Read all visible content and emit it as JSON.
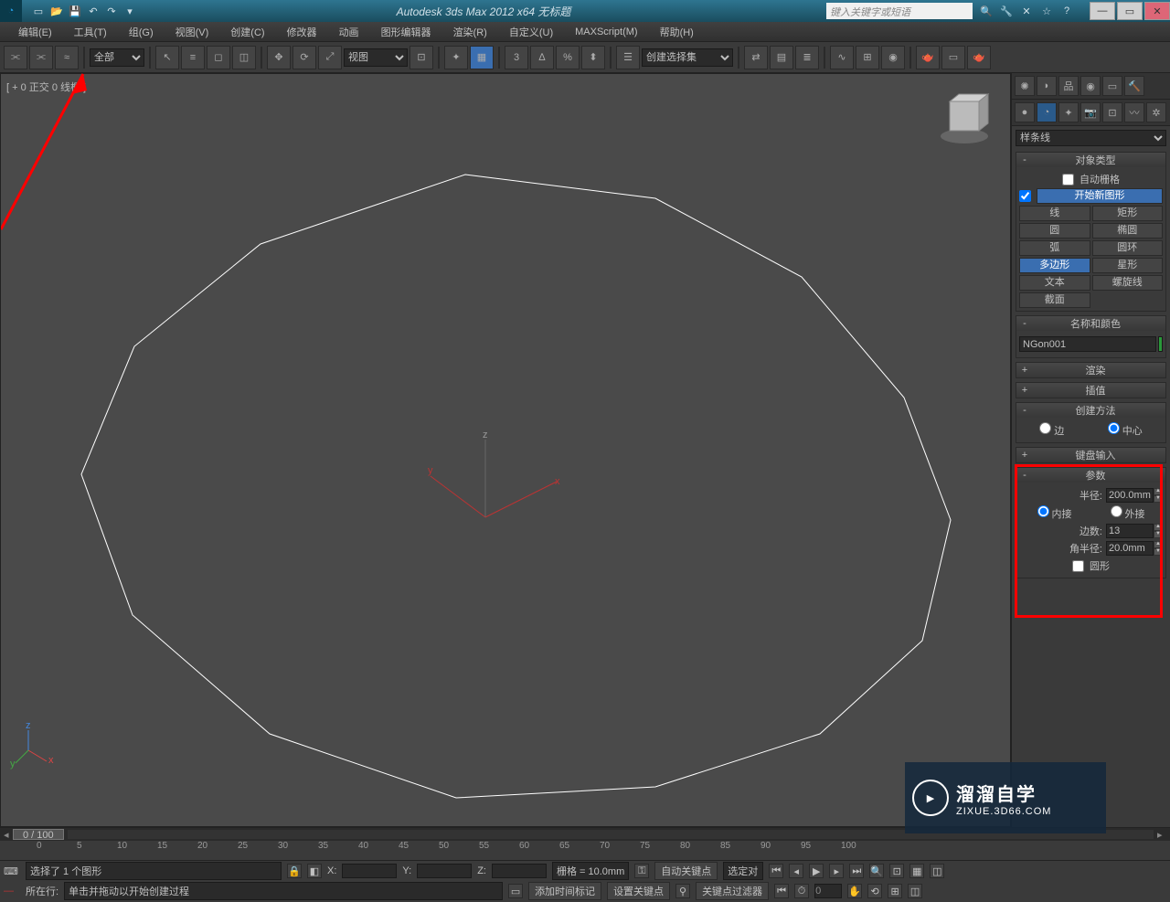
{
  "app": {
    "title": "Autodesk 3ds Max  2012 x64     无标题",
    "search_placeholder": "键入关键字或短语"
  },
  "menu": {
    "edit": "编辑(E)",
    "tools": "工具(T)",
    "group": "组(G)",
    "views": "视图(V)",
    "create": "创建(C)",
    "modifiers": "修改器",
    "animation": "动画",
    "graph": "图形编辑器",
    "rendering": "渲染(R)",
    "customize": "自定义(U)",
    "maxscript": "MAXScript(M)",
    "help": "帮助(H)"
  },
  "toolbar": {
    "filter_all": "全部",
    "view_label": "视图",
    "create_sel": "创建选择集"
  },
  "viewport": {
    "label": "[ + 0 正交 0 线框 ]"
  },
  "panel": {
    "dropdown": "样条线",
    "object_type": {
      "header": "对象类型",
      "auto_grid": "自动栅格",
      "start_shape": "开始新图形",
      "buttons": {
        "line": "线",
        "rectangle": "矩形",
        "circle": "圆",
        "ellipse": "椭圆",
        "arc": "弧",
        "donut": "圆环",
        "ngon": "多边形",
        "star": "星形",
        "text": "文本",
        "helix": "螺旋线",
        "section": "截面"
      }
    },
    "name_color": {
      "header": "名称和颜色",
      "name_value": "NGon001"
    },
    "rendering": {
      "header": "渲染"
    },
    "interpolation": {
      "header": "插值"
    },
    "creation_method": {
      "header": "创建方法",
      "edge": "边",
      "center": "中心"
    },
    "keyboard_entry": {
      "header": "键盘输入"
    },
    "parameters": {
      "header": "参数",
      "radius_label": "半径:",
      "radius_value": "200.0mm",
      "inscribed": "内接",
      "circumscribed": "外接",
      "sides_label": "边数:",
      "sides_value": "13",
      "corner_radius_label": "角半径:",
      "corner_radius_value": "20.0mm",
      "circular": "圆形"
    }
  },
  "timeline": {
    "frame": "0 / 100",
    "ticks": [
      "0",
      "5",
      "10",
      "15",
      "20",
      "25",
      "30",
      "35",
      "40",
      "45",
      "50",
      "55",
      "60",
      "65",
      "70",
      "75",
      "80",
      "85",
      "90",
      "95",
      "100"
    ]
  },
  "status": {
    "selected": "选择了 1 个图形",
    "x_label": "X:",
    "y_label": "Y:",
    "z_label": "Z:",
    "grid": "栅格 = 10.0mm",
    "autokey": "自动关键点",
    "sel_obj": "选定对",
    "prompt": "单击并拖动以开始创建过程",
    "add_time_tag": "添加时间标记",
    "set_key": "设置关键点",
    "key_filter": "关键点过滤器",
    "cursor_row": "所在行:",
    "frame_num": "0"
  },
  "watermark": {
    "cn": "溜溜自学",
    "en": "ZIXUE.3D66.COM"
  }
}
